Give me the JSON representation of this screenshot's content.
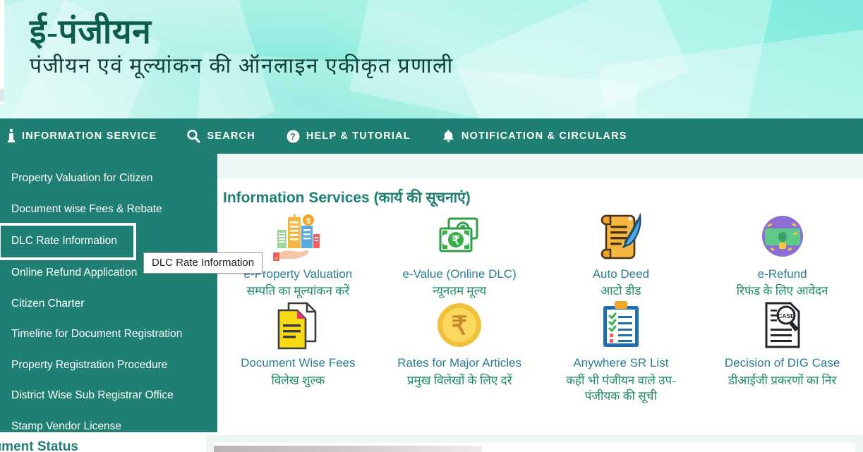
{
  "header": {
    "logo_title": "ई-पंजीयन",
    "logo_subtitle": "पंजीयन एवं मूल्यांकन की ऑनलाइन एकीकृत प्रणाली",
    "brand_color": "#0d5c4e",
    "banner_color": "#8df0e2"
  },
  "navbar": {
    "accent_color": "#1e7f72",
    "items": [
      {
        "label": "INFORMATION SERVICE",
        "icon": "info-icon"
      },
      {
        "label": "SEARCH",
        "icon": "search-icon"
      },
      {
        "label": "HELP & TUTORIAL",
        "icon": "help-circle-icon"
      },
      {
        "label": "NOTIFICATION & CIRCULARS",
        "icon": "bell-icon"
      }
    ]
  },
  "sidebar": {
    "background_color": "#1e7f72",
    "items": [
      {
        "label": "Property Valuation for Citizen",
        "active": false
      },
      {
        "label": "Document wise Fees & Rebate",
        "active": false
      },
      {
        "label": "DLC Rate Information",
        "active": true
      },
      {
        "label": "Online Refund Application",
        "active": false
      },
      {
        "label": "Citizen Charter",
        "active": false
      },
      {
        "label": "Timeline for Document Registration",
        "active": false
      },
      {
        "label": "Property Registration Procedure",
        "active": false
      },
      {
        "label": "District Wise Sub Registrar Office",
        "active": false
      },
      {
        "label": "Stamp Vendor License",
        "active": false
      }
    ]
  },
  "tooltip": {
    "text": "DLC Rate Information"
  },
  "main": {
    "title": "Information Services (कार्य की सूचनाएं)",
    "title_color": "#1e7f72",
    "services": [
      {
        "en": "e-Property Valuation",
        "hi": "सम्पति का मूल्यांकन करें",
        "icon": "building-hand-icon"
      },
      {
        "en": "e-Value (Online DLC)",
        "hi": "न्यूनतम मूल्य",
        "icon": "rupee-banknotes-icon"
      },
      {
        "en": "Auto Deed",
        "hi": "आटो डीड",
        "icon": "scroll-quill-icon"
      },
      {
        "en": "e-Refund",
        "hi": "रिफंड के लिए आवेदन",
        "icon": "money-circle-icon"
      },
      {
        "en": "Document Wise Fees",
        "hi": "विलेख शुल्क",
        "icon": "documents-icon"
      },
      {
        "en": "Rates for Major Articles",
        "hi": "प्रमुख विलेखों के लिए दरें",
        "icon": "rupee-coin-icon"
      },
      {
        "en": "Anywhere SR List",
        "hi": "कहीं भी पंजीयन वाले उप-पंजीयक की सूची",
        "icon": "clipboard-check-icon"
      },
      {
        "en": "Decision of DIG Case",
        "hi": "डीआईजी प्रकरणों का निर",
        "icon": "case-document-icon"
      }
    ]
  },
  "below": {
    "title": "cument Status"
  }
}
